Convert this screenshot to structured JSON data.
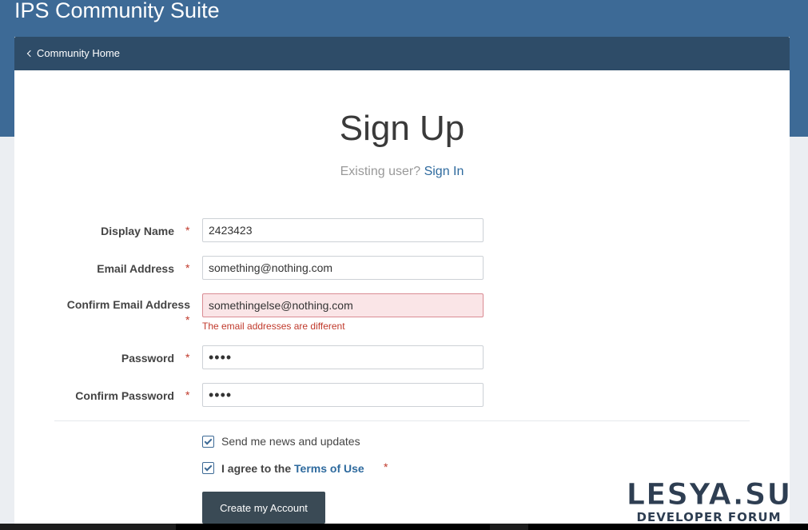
{
  "site": {
    "title": "IPS Community Suite"
  },
  "nav": {
    "back_label": "Community Home"
  },
  "page": {
    "title": "Sign Up",
    "existing_user_text": "Existing user?",
    "sign_in_link": "Sign In"
  },
  "form": {
    "required_marker": "*",
    "display_name": {
      "label": "Display Name",
      "value": "2423423"
    },
    "email": {
      "label": "Email Address",
      "value": "something@nothing.com"
    },
    "confirm_email": {
      "label": "Confirm Email Address",
      "value": "somethingelse@nothing.com",
      "error": "The email addresses are different"
    },
    "password": {
      "label": "Password",
      "value": "••••"
    },
    "confirm_password": {
      "label": "Confirm Password",
      "value": "••••"
    },
    "newsletter": {
      "label": "Send me news and updates",
      "checked": true
    },
    "terms": {
      "label_prefix": "I agree to the",
      "link": "Terms of Use",
      "checked": true
    },
    "submit_label": "Create my Account"
  },
  "watermark": {
    "main": "LESYA.SU",
    "sub": "DEVELOPER FORUM"
  },
  "colors": {
    "header_band": "#3d6a96",
    "nav_bar": "#2e4c68",
    "link": "#2e6a9e",
    "error": "#c0392b",
    "error_field_bg": "#fae5e7",
    "button": "#3a4a55"
  }
}
